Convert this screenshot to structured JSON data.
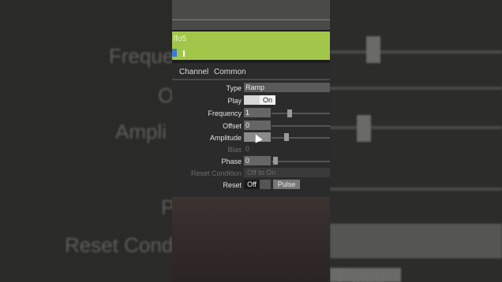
{
  "component_name": "lfo5",
  "tabs": [
    "Channel",
    "Common"
  ],
  "params": {
    "type_label": "Type",
    "type_value": "Ramp",
    "play_label": "Play",
    "play_value": "On",
    "frequency_label": "Frequency",
    "frequency_value": "1",
    "offset_label": "Offset",
    "offset_value": "0",
    "amplitude_label": "Amplitude",
    "amplitude_value": "1",
    "bias_label": "Bias",
    "bias_value": "0",
    "phase_label": "Phase",
    "phase_value": "0",
    "reset_condition_label": "Reset Condition",
    "reset_condition_value": "Off to On",
    "reset_label": "Reset",
    "reset_value": "Off",
    "pulse_label": "Pulse"
  },
  "background": {
    "left_frequency": "Freque",
    "left_offset": "O",
    "left_amplitude": "Ampli",
    "left_phase": "P",
    "left_reset_condition": "Reset Cond",
    "right_pulse": "Pulse"
  },
  "colors": {
    "green_bar": "#a2c64a",
    "panel": "#2b2b2b",
    "field": "#666666"
  }
}
